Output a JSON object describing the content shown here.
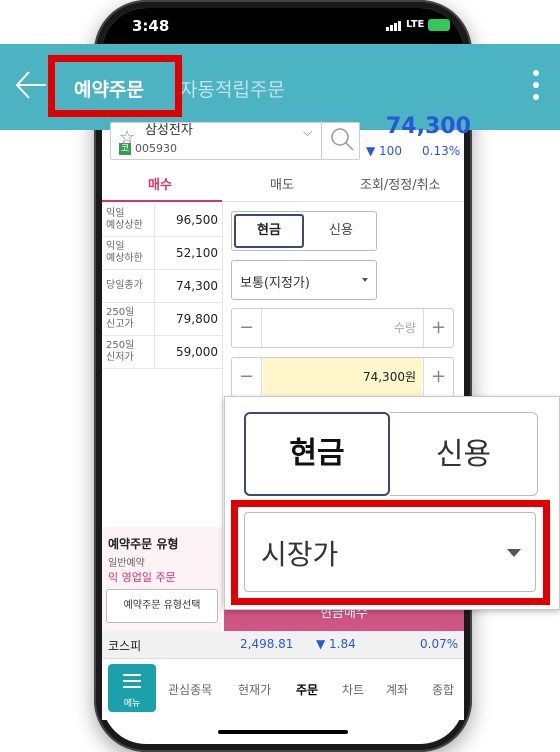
{
  "status_bar": {
    "time": "3:48",
    "network": "LTE"
  },
  "app_bar": {
    "title_active": "예약주문",
    "title_inactive": "자동적립주문"
  },
  "stock": {
    "name": "삼성전자",
    "market_badge": "코",
    "code": "005930",
    "price": "74,300",
    "change": "▼ 100",
    "change_pct": "0.13%"
  },
  "tabs": [
    "매수",
    "매도",
    "조회/정정/취소"
  ],
  "info_rows": [
    {
      "label": "익일\n예상상한",
      "value": "96,500"
    },
    {
      "label": "익일\n예상하한",
      "value": "52,100"
    },
    {
      "label": "당일종가",
      "value": "74,300"
    },
    {
      "label": "250일\n신고가",
      "value": "79,800"
    },
    {
      "label": "250일\n신저가",
      "value": "59,000"
    }
  ],
  "order_form": {
    "cash_label": "현금",
    "credit_label": "신용",
    "order_type": "보통(지정가)",
    "quantity_placeholder": "수량",
    "price_value": "74,300원"
  },
  "reserve": {
    "title": "예약주문 유형",
    "type": "일반예약",
    "next_day": "익 영업일 주문",
    "select_button": "예약주문 유형선택"
  },
  "order_button": "현금매수",
  "kospi": {
    "name": "코스피",
    "value": "2,498.81",
    "change": "▼ 1.84",
    "pct": "0.07%"
  },
  "bottom_nav": {
    "menu_label": "메뉴",
    "items": [
      "관심종목",
      "현재가",
      "주문",
      "차트",
      "계좌",
      "종합"
    ]
  },
  "zoom": {
    "cash_label": "현금",
    "credit_label": "신용",
    "order_type": "시장가"
  }
}
